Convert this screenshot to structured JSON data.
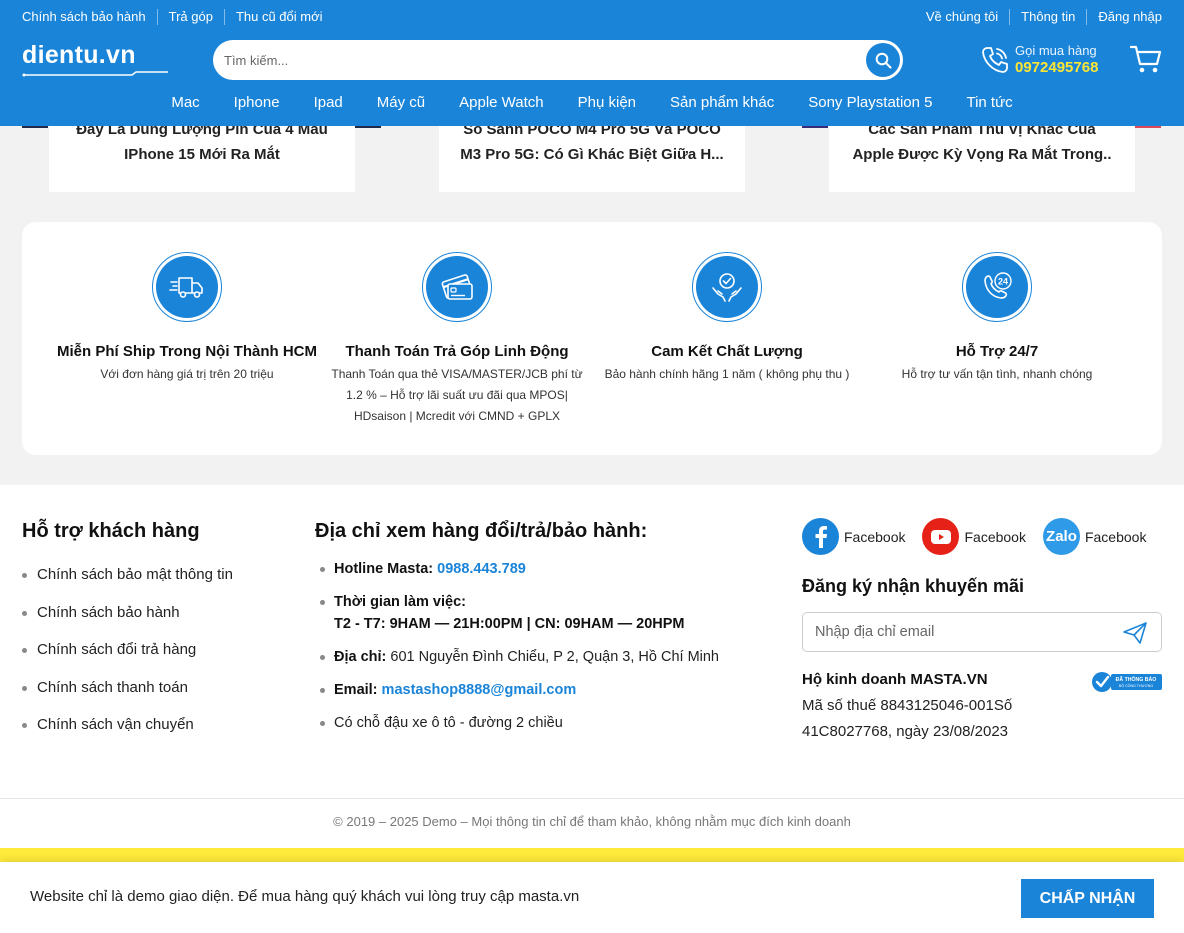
{
  "header": {
    "topbar_left": [
      "Chính sách bảo hành",
      "Trả góp",
      "Thu cũ đổi mới"
    ],
    "topbar_right": [
      "Về chúng tôi",
      "Thông tin",
      "Đăng nhập"
    ],
    "logo": "dientu.vn",
    "search_placeholder": "Tìm kiếm...",
    "hotline_label": "Gọi mua hàng",
    "hotline_number": "0972495768",
    "nav": [
      "Mac",
      "Iphone",
      "Ipad",
      "Máy cũ",
      "Apple Watch",
      "Phụ kiện",
      "Sản phẩm khác",
      "Sony Playstation 5",
      "Tin tức"
    ]
  },
  "articles": [
    {
      "line1": "Đây Là Dung Lượng Pin Của 4 Mẫu",
      "line2": "IPhone 15 Mới Ra Mắt"
    },
    {
      "line1": "So Sánh POCO M4 Pro 5G Và POCO",
      "line2": "M3 Pro 5G: Có Gì Khác Biệt Giữa H..."
    },
    {
      "line1": "Các Sản Phẩm Thú Vị Khác Của",
      "line2": "Apple Được Kỳ Vọng Ra Mắt Trong.."
    }
  ],
  "features": [
    {
      "icon": "truck-icon",
      "title": "Miễn Phí Ship Trong Nội Thành HCM",
      "desc": "Với đơn hàng giá trị trên 20 triệu"
    },
    {
      "icon": "credit-card-icon",
      "title": "Thanh Toán Trả Góp Linh Động",
      "desc": "Thanh Toán qua thẻ VISA/MASTER/JCB phí từ 1.2 % – Hỗ trợ lãi suất ưu đãi qua MPOS| HDsaison | Mcredit với CMND + GPLX"
    },
    {
      "icon": "quality-hands-icon",
      "title": "Cam Kết Chất Lượng",
      "desc": "Bảo hành chính hãng 1 năm ( không phụ thu )"
    },
    {
      "icon": "support-24-icon",
      "title": "Hỗ Trợ 24/7",
      "desc": "Hỗ trợ tư vấn tận tình, nhanh chóng"
    }
  ],
  "footer": {
    "support_title": "Hỗ trợ khách hàng",
    "support_links": [
      "Chính sách bảo mật thông tin",
      "Chính sách bảo hành",
      "Chính sách đổi trả hàng",
      "Chính sách thanh toán",
      "Chính sách vận chuyển"
    ],
    "address_title": "Địa chỉ xem hàng đổi/trả/bảo hành:",
    "hotline_label": "Hotline Masta:",
    "hotline_value": "0988.443.789",
    "hours_label": "Thời gian làm việc:",
    "hours_value": "T2 - T7: 9HAM — 21H:00PM | CN: 09HAM — 20HPM",
    "address_label": "Địa chỉ:",
    "address_value": "601 Nguyễn Đình Chiểu, P 2, Quận 3, Hồ Chí Minh",
    "email_label": "Email:",
    "email_value": "mastashop8888@gmail.com",
    "parking": "Có chỗ đậu xe ô tô - đường 2 chiều",
    "socials": [
      {
        "icon": "facebook-icon",
        "label": "Facebook",
        "color": "#1a84d9"
      },
      {
        "icon": "youtube-icon",
        "label": "Facebook",
        "color": "#e62117"
      },
      {
        "icon": "zalo-icon",
        "label": "Facebook",
        "color": "#2f9be8",
        "mark": "Zalo"
      }
    ],
    "promo_title": "Đăng ký nhận khuyến mãi",
    "email_placeholder": "Nhập địa chỉ email",
    "biz_name": "Hộ kinh doanh MASTA.VN",
    "biz_detail": "Mã số thuế 8843125046-001Số 41C8027768, ngày 23/08/2023",
    "badge_text": "ĐÃ THÔNG BÁO",
    "badge_sub": "BỘ CÔNG THƯƠNG"
  },
  "copyright": "© 2019 – 2025 Demo – Mọi thông tin chỉ để tham khảo, không nhằm mục đích kinh doanh",
  "cookie": {
    "text": "Website chỉ là demo giao diện. Để mua hàng quý khách vui lòng truy cập masta.vn",
    "button": "CHẤP NHẬN"
  },
  "colors": {
    "primary": "#1a84d9",
    "accent": "#ffe533",
    "strip": "#ffeb3b"
  }
}
